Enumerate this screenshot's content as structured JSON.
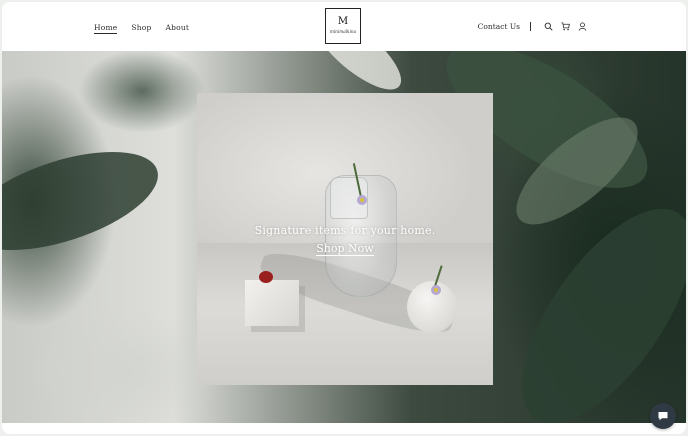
{
  "nav": {
    "left_links": [
      {
        "label": "Home",
        "active": true
      },
      {
        "label": "Shop",
        "active": false
      },
      {
        "label": "About",
        "active": false
      }
    ],
    "contact_label": "Contact Us",
    "icons": [
      "search-icon",
      "cart-icon",
      "user-icon"
    ]
  },
  "logo": {
    "letter": "M",
    "wordmark": "minimalkina"
  },
  "hero": {
    "tagline": "Signature items for your home.",
    "cta_label": "Shop Now"
  },
  "chat": {
    "icon": "chat-icon"
  },
  "colors": {
    "header_bg": "#ffffff",
    "text_dark": "#2b2b2b",
    "chat_button": "#2f3a44",
    "hero_text": "#ffffff"
  }
}
